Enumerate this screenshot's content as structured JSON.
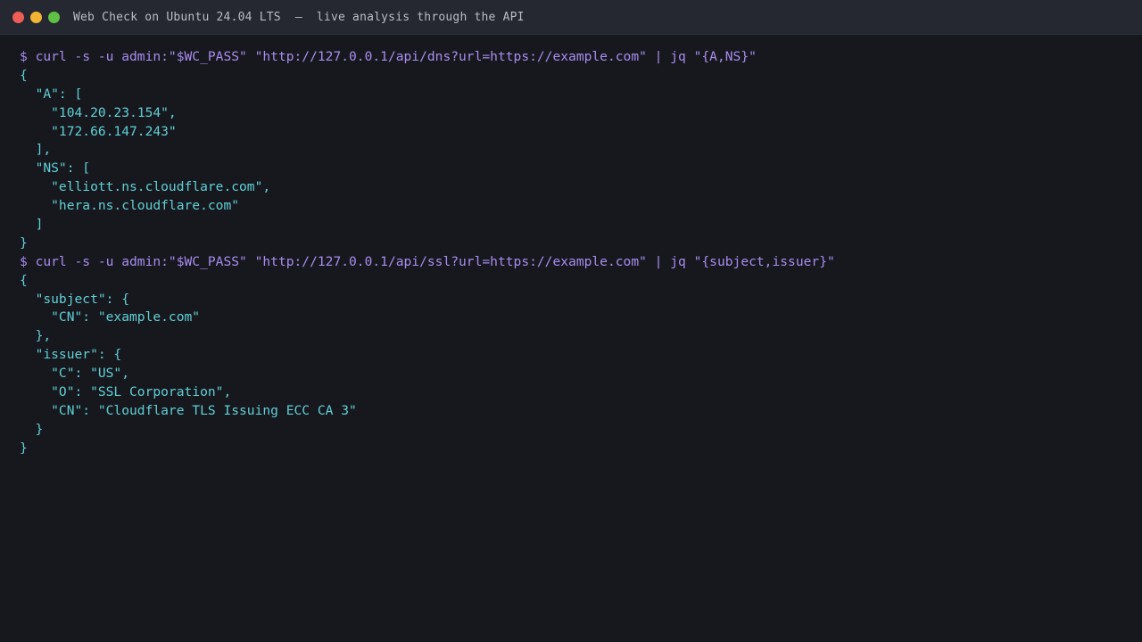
{
  "window": {
    "title": "Web Check on Ubuntu 24.04 LTS  –  live analysis through the API",
    "colors": {
      "close": "#ee5e57",
      "minimize": "#f4b433",
      "maximize": "#5fc145",
      "command": "#a88cf0",
      "output": "#5fd0d7",
      "background": "#17181d",
      "titlebar": "#252830"
    }
  },
  "terminal": {
    "lines": [
      {
        "kind": "cmd",
        "text": "$ curl -s -u admin:\"$WC_PASS\" \"http://127.0.0.1/api/dns?url=https://example.com\" | jq \"{A,NS}\""
      },
      {
        "kind": "out",
        "text": "{"
      },
      {
        "kind": "out",
        "text": "  \"A\": ["
      },
      {
        "kind": "out",
        "text": "    \"104.20.23.154\","
      },
      {
        "kind": "out",
        "text": "    \"172.66.147.243\""
      },
      {
        "kind": "out",
        "text": "  ],"
      },
      {
        "kind": "out",
        "text": "  \"NS\": ["
      },
      {
        "kind": "out",
        "text": "    \"elliott.ns.cloudflare.com\","
      },
      {
        "kind": "out",
        "text": "    \"hera.ns.cloudflare.com\""
      },
      {
        "kind": "out",
        "text": "  ]"
      },
      {
        "kind": "out",
        "text": "}"
      },
      {
        "kind": "cmd",
        "text": "$ curl -s -u admin:\"$WC_PASS\" \"http://127.0.0.1/api/ssl?url=https://example.com\" | jq \"{subject,issuer}\""
      },
      {
        "kind": "out",
        "text": "{"
      },
      {
        "kind": "out",
        "text": "  \"subject\": {"
      },
      {
        "kind": "out",
        "text": "    \"CN\": \"example.com\""
      },
      {
        "kind": "out",
        "text": "  },"
      },
      {
        "kind": "out",
        "text": "  \"issuer\": {"
      },
      {
        "kind": "out",
        "text": "    \"C\": \"US\","
      },
      {
        "kind": "out",
        "text": "    \"O\": \"SSL Corporation\","
      },
      {
        "kind": "out",
        "text": "    \"CN\": \"Cloudflare TLS Issuing ECC CA 3\""
      },
      {
        "kind": "out",
        "text": "  }"
      },
      {
        "kind": "out",
        "text": "}"
      }
    ]
  }
}
